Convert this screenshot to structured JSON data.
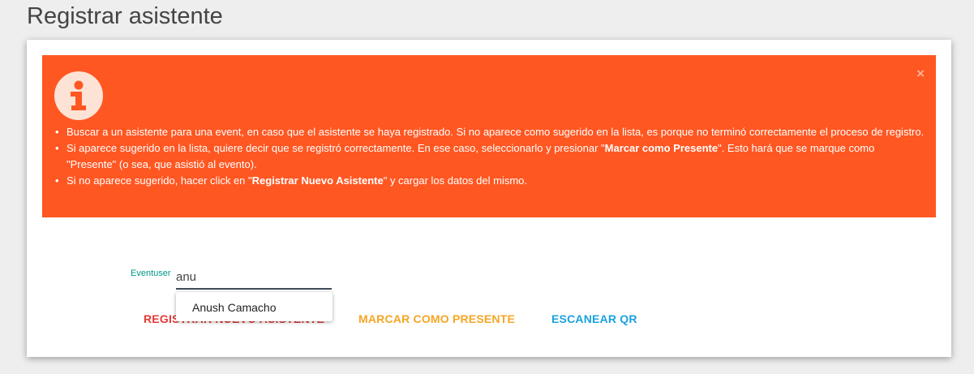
{
  "page": {
    "title": "Registrar asistente"
  },
  "alert": {
    "close_label": "×",
    "icon": "info-icon",
    "items": [
      {
        "before": "Buscar a un asistente para una event, en caso que el asistente se haya registrado. Si no aparece como sugerido en la lista, es porque no terminó correctamente el proceso de registro.",
        "bold": "",
        "after": ""
      },
      {
        "before": "Si aparece sugerido en la lista, quiere decir que se registró correctamente. En ese caso, seleccionarlo y presionar \"",
        "bold": "Marcar como Presente",
        "after": "\". Esto hará que se marque como \"Presente\" (o sea, que asistió al evento)."
      },
      {
        "before": "Si no aparece sugerido, hacer click en \"",
        "bold": "Registrar Nuevo Asistente",
        "after": "\" y cargar los datos del mismo."
      }
    ]
  },
  "form": {
    "label": "Eventuser",
    "value": "anu"
  },
  "autocomplete": {
    "items": [
      "Anush Camacho"
    ]
  },
  "actions": {
    "register": "REGISTRAR NUEVO ASISTENTE",
    "present": "MARCAR COMO PRESENTE",
    "qr": "ESCANEAR QR"
  },
  "colors": {
    "alert_bg": "#ff5722",
    "register": "#e53935",
    "present": "#f5a623",
    "qr": "#1ba1e2",
    "label": "#009688"
  }
}
